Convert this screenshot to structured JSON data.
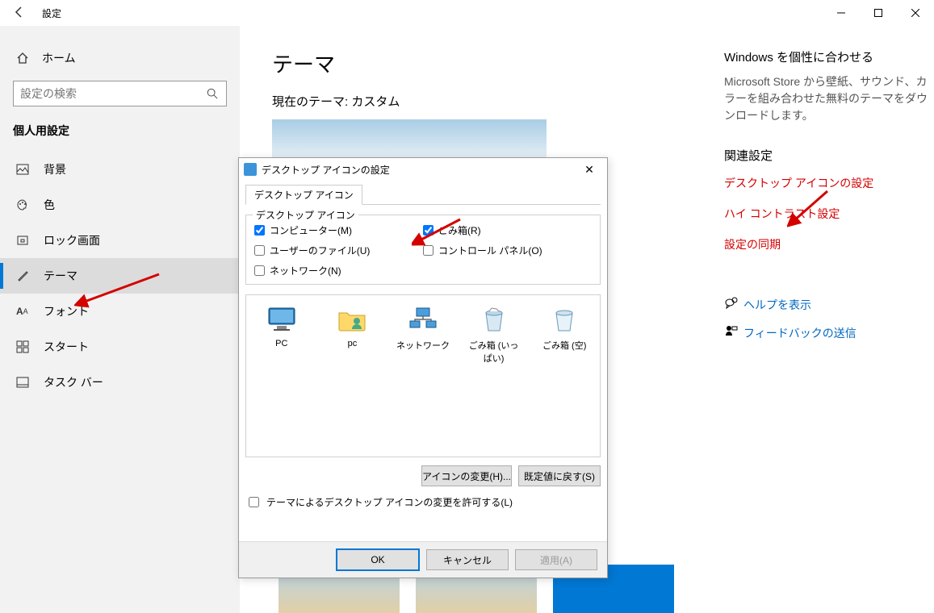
{
  "titlebar": {
    "title": "設定"
  },
  "sidebar": {
    "home": "ホーム",
    "search_placeholder": "設定の検索",
    "group": "個人用設定",
    "items": [
      {
        "icon": "picture",
        "label": "背景"
      },
      {
        "icon": "palette",
        "label": "色"
      },
      {
        "icon": "lock",
        "label": "ロック画面"
      },
      {
        "icon": "brush",
        "label": "テーマ"
      },
      {
        "icon": "font",
        "label": "フォント"
      },
      {
        "icon": "grid",
        "label": "スタート"
      },
      {
        "icon": "taskbar",
        "label": "タスク バー"
      }
    ],
    "active_index": 3
  },
  "main": {
    "heading": "テーマ",
    "subheading": "現在のテーマ: カスタム"
  },
  "right": {
    "title": "Windows を個性に合わせる",
    "text": "Microsoft Store から壁紙、サウンド、カラーを組み合わせた無料のテーマをダウンロードします。",
    "related_title": "関連設定",
    "links": [
      "デスクトップ アイコンの設定",
      "ハイ コントラスト設定",
      "設定の同期"
    ],
    "help": "ヘルプを表示",
    "feedback": "フィードバックの送信"
  },
  "dialog": {
    "title": "デスクトップ アイコンの設定",
    "tab": "デスクトップ アイコン",
    "group_label": "デスクトップ アイコン",
    "checks": [
      {
        "label": "コンピューター(M)",
        "checked": true
      },
      {
        "label": "ごみ箱(R)",
        "checked": true
      },
      {
        "label": "ユーザーのファイル(U)",
        "checked": false
      },
      {
        "label": "コントロール パネル(O)",
        "checked": false
      },
      {
        "label": "ネットワーク(N)",
        "checked": false
      }
    ],
    "icons": [
      "PC",
      "pc",
      "ネットワーク",
      "ごみ箱 (いっぱい)",
      "ごみ箱 (空)"
    ],
    "change_btn": "アイコンの変更(H)...",
    "default_btn": "既定値に戻す(S)",
    "allow_label": "テーマによるデスクトップ アイコンの変更を許可する(L)",
    "ok": "OK",
    "cancel": "キャンセル",
    "apply": "適用(A)"
  }
}
